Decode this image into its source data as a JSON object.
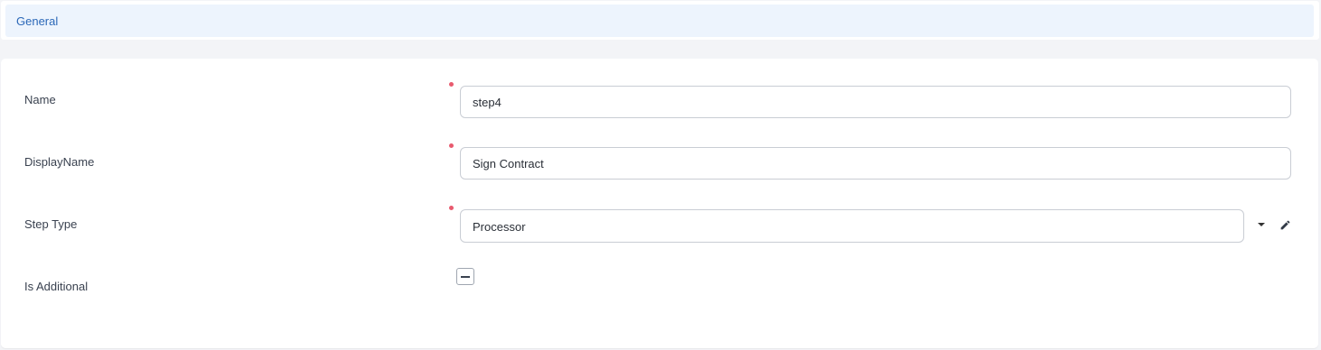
{
  "section": {
    "title": "General"
  },
  "form": {
    "fields": [
      {
        "label": "Name",
        "value": "step4",
        "required": true
      },
      {
        "label": "DisplayName",
        "value": "Sign Contract",
        "required": true
      },
      {
        "label": "Step Type",
        "value": "Processor",
        "required": true
      },
      {
        "label": "Is Additional",
        "value": "indeterminate",
        "required": false
      }
    ]
  },
  "icons": {
    "dropdown": "caret-down-icon",
    "edit": "pencil-icon",
    "checkbox_state": "dash-icon"
  },
  "colors": {
    "accent": "#2b68b8",
    "required": "#e85a6e",
    "header_bg": "#edf4fd"
  }
}
